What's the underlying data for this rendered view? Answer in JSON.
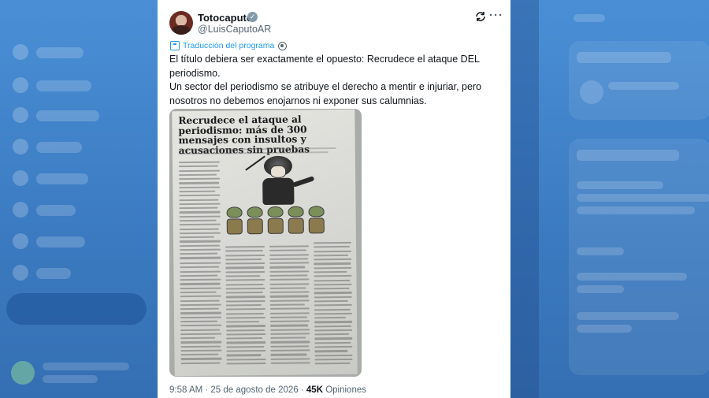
{
  "tweet": {
    "display_name": "Totocaputo",
    "handle": "@LuisCaputoAR",
    "translation_label": "Traducción del programa",
    "text_lines": [
      "El título debiera ser exactamente el opuesto: Recrudece el ataque DEL periodismo.",
      "Un sector del periodismo se atribuye el derecho a mentir e injuriar, pero nosotros no debemos enojarnos ni exponer sus calumnias."
    ],
    "timestamp": "9:58 AM · 25 de agosto de 2026 · ",
    "views_count": "45K",
    "views_label": " Opiniones"
  },
  "newspaper": {
    "headline": "Recrudece el ataque al periodismo: más de 300 mensajes con insultos y acusaciones sin pruebas"
  },
  "icons": {
    "verified": "verified-badge-icon",
    "refresh": "refresh-icon",
    "more": "more-options-icon",
    "translate": "translate-icon",
    "settings": "gear-icon"
  },
  "colors": {
    "accent": "#1d9bf0",
    "secondary_text": "#536471",
    "background_overlay": "#3d7fc4"
  }
}
